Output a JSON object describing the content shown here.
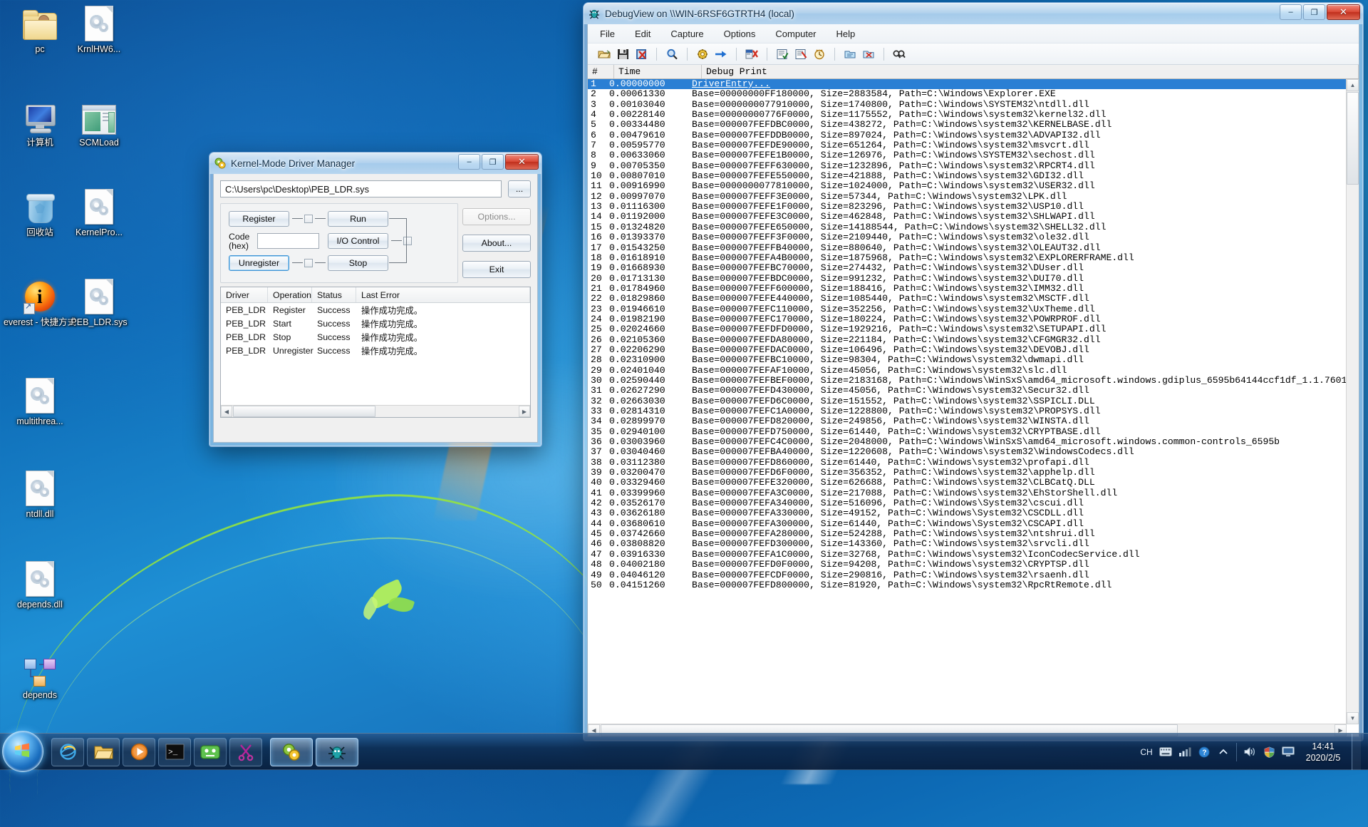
{
  "desktop": {
    "icons": [
      {
        "label": "pc",
        "type": "folder-user-icon"
      },
      {
        "label": "KrnlHW6...",
        "type": "file-gears-icon"
      },
      {
        "label": "计算机",
        "type": "computer-icon"
      },
      {
        "label": "SCMLoad",
        "type": "app-window-icon"
      },
      {
        "label": "回收站",
        "type": "recycle-bin-icon"
      },
      {
        "label": "KernelPro...",
        "type": "file-gears-icon"
      },
      {
        "label": "everest - 快捷方式",
        "type": "everest-shortcut-icon"
      },
      {
        "label": "PEB_LDR.sys",
        "type": "file-gears-icon"
      },
      {
        "label": "multithrea...",
        "type": "file-gears-icon"
      },
      {
        "label": "ntdll.dll",
        "type": "file-gears-icon"
      },
      {
        "label": "depends.dll",
        "type": "file-gears-icon"
      },
      {
        "label": "depends",
        "type": "depends-icon"
      }
    ]
  },
  "debugview": {
    "title": "DebugView on \\\\WIN-6RSF6GTRTH4 (local)",
    "menu": [
      "File",
      "Edit",
      "Capture",
      "Options",
      "Computer",
      "Help"
    ],
    "toolbar_icons": [
      "open-icon",
      "save-icon",
      "clear-icon",
      "find-icon",
      "capture-win32-icon",
      "capture-kernel-icon",
      "autoscroll-icon",
      "filter-icon",
      "highlight-icon",
      "clock-icon",
      "log-to-file-icon",
      "log-boot-icon",
      "find-next-icon"
    ],
    "columns": [
      "#",
      "Time",
      "Debug Print"
    ],
    "window_buttons": {
      "minimize": "–",
      "maximize": "❐",
      "close": "✕"
    },
    "rows": [
      {
        "n": "1",
        "t": "0.00000000",
        "p": "DriverEntry..."
      },
      {
        "n": "2",
        "t": "0.00061330",
        "p": "Base=00000000FF180000, Size=2883584, Path=C:\\Windows\\Explorer.EXE"
      },
      {
        "n": "3",
        "t": "0.00103040",
        "p": "Base=0000000077910000, Size=1740800, Path=C:\\Windows\\SYSTEM32\\ntdll.dll"
      },
      {
        "n": "4",
        "t": "0.00228140",
        "p": "Base=00000000776F0000, Size=1175552, Path=C:\\Windows\\system32\\kernel32.dll"
      },
      {
        "n": "5",
        "t": "0.00334480",
        "p": "Base=000007FEFDBC0000, Size=438272, Path=C:\\Windows\\system32\\KERNELBASE.dll"
      },
      {
        "n": "6",
        "t": "0.00479610",
        "p": "Base=000007FEFDDB0000, Size=897024, Path=C:\\Windows\\system32\\ADVAPI32.dll"
      },
      {
        "n": "7",
        "t": "0.00595770",
        "p": "Base=000007FEFDE90000, Size=651264, Path=C:\\Windows\\system32\\msvcrt.dll"
      },
      {
        "n": "8",
        "t": "0.00633060",
        "p": "Base=000007FEFE1B0000, Size=126976, Path=C:\\Windows\\SYSTEM32\\sechost.dll"
      },
      {
        "n": "9",
        "t": "0.00705350",
        "p": "Base=000007FEFF630000, Size=1232896, Path=C:\\Windows\\system32\\RPCRT4.dll"
      },
      {
        "n": "10",
        "t": "0.00807010",
        "p": "Base=000007FEFE550000, Size=421888, Path=C:\\Windows\\system32\\GDI32.dll"
      },
      {
        "n": "11",
        "t": "0.00916990",
        "p": "Base=0000000077810000, Size=1024000, Path=C:\\Windows\\system32\\USER32.dll"
      },
      {
        "n": "12",
        "t": "0.00997070",
        "p": "Base=000007FEFF3E0000, Size=57344, Path=C:\\Windows\\system32\\LPK.dll"
      },
      {
        "n": "13",
        "t": "0.01116300",
        "p": "Base=000007FEFE1F0000, Size=823296, Path=C:\\Windows\\system32\\USP10.dll"
      },
      {
        "n": "14",
        "t": "0.01192000",
        "p": "Base=000007FEFE3C0000, Size=462848, Path=C:\\Windows\\system32\\SHLWAPI.dll"
      },
      {
        "n": "15",
        "t": "0.01324820",
        "p": "Base=000007FEFE650000, Size=14188544, Path=C:\\Windows\\system32\\SHELL32.dll"
      },
      {
        "n": "16",
        "t": "0.01393370",
        "p": "Base=000007FEFF3F0000, Size=2109440, Path=C:\\Windows\\system32\\ole32.dll"
      },
      {
        "n": "17",
        "t": "0.01543250",
        "p": "Base=000007FEFFB40000, Size=880640, Path=C:\\Windows\\system32\\OLEAUT32.dll"
      },
      {
        "n": "18",
        "t": "0.01618910",
        "p": "Base=000007FEFA4B0000, Size=1875968, Path=C:\\Windows\\system32\\EXPLORERFRAME.dll"
      },
      {
        "n": "19",
        "t": "0.01668930",
        "p": "Base=000007FEFBC70000, Size=274432, Path=C:\\Windows\\system32\\DUser.dll"
      },
      {
        "n": "20",
        "t": "0.01713130",
        "p": "Base=000007FEFBDC0000, Size=991232, Path=C:\\Windows\\system32\\DUI70.dll"
      },
      {
        "n": "21",
        "t": "0.01784960",
        "p": "Base=000007FEFF600000, Size=188416, Path=C:\\Windows\\system32\\IMM32.dll"
      },
      {
        "n": "22",
        "t": "0.01829860",
        "p": "Base=000007FEFE440000, Size=1085440, Path=C:\\Windows\\system32\\MSCTF.dll"
      },
      {
        "n": "23",
        "t": "0.01946610",
        "p": "Base=000007FEFC110000, Size=352256, Path=C:\\Windows\\system32\\UxTheme.dll"
      },
      {
        "n": "24",
        "t": "0.01982190",
        "p": "Base=000007FEFC170000, Size=180224, Path=C:\\Windows\\system32\\POWRPROF.dll"
      },
      {
        "n": "25",
        "t": "0.02024660",
        "p": "Base=000007FEFDFD0000, Size=1929216, Path=C:\\Windows\\system32\\SETUPAPI.dll"
      },
      {
        "n": "26",
        "t": "0.02105360",
        "p": "Base=000007FEFDA80000, Size=221184, Path=C:\\Windows\\system32\\CFGMGR32.dll"
      },
      {
        "n": "27",
        "t": "0.02206290",
        "p": "Base=000007FEFDAC0000, Size=106496, Path=C:\\Windows\\system32\\DEVOBJ.dll"
      },
      {
        "n": "28",
        "t": "0.02310900",
        "p": "Base=000007FEFBC10000, Size=98304, Path=C:\\Windows\\system32\\dwmapi.dll"
      },
      {
        "n": "29",
        "t": "0.02401040",
        "p": "Base=000007FEFAF10000, Size=45056, Path=C:\\Windows\\system32\\slc.dll"
      },
      {
        "n": "30",
        "t": "0.02590440",
        "p": "Base=000007FEFBEF0000, Size=2183168, Path=C:\\Windows\\WinSxS\\amd64_microsoft.windows.gdiplus_6595b64144ccf1df_1.1.7601"
      },
      {
        "n": "31",
        "t": "0.02627290",
        "p": "Base=000007FEFD430000, Size=45056, Path=C:\\Windows\\system32\\Secur32.dll"
      },
      {
        "n": "32",
        "t": "0.02663030",
        "p": "Base=000007FEFD6C0000, Size=151552, Path=C:\\Windows\\system32\\SSPICLI.DLL"
      },
      {
        "n": "33",
        "t": "0.02814310",
        "p": "Base=000007FEFC1A0000, Size=1228800, Path=C:\\Windows\\system32\\PROPSYS.dll"
      },
      {
        "n": "34",
        "t": "0.02899970",
        "p": "Base=000007FEFD820000, Size=249856, Path=C:\\Windows\\system32\\WINSTA.dll"
      },
      {
        "n": "35",
        "t": "0.02940100",
        "p": "Base=000007FEFD750000, Size=61440, Path=C:\\Windows\\system32\\CRYPTBASE.dll"
      },
      {
        "n": "36",
        "t": "0.03003960",
        "p": "Base=000007FEFC4C0000, Size=2048000, Path=C:\\Windows\\WinSxS\\amd64_microsoft.windows.common-controls_6595b"
      },
      {
        "n": "37",
        "t": "0.03040460",
        "p": "Base=000007FEFBA40000, Size=1220608, Path=C:\\Windows\\system32\\WindowsCodecs.dll"
      },
      {
        "n": "38",
        "t": "0.03112380",
        "p": "Base=000007FEFD860000, Size=61440, Path=C:\\Windows\\system32\\profapi.dll"
      },
      {
        "n": "39",
        "t": "0.03200470",
        "p": "Base=000007FEFD6F0000, Size=356352, Path=C:\\Windows\\system32\\apphelp.dll"
      },
      {
        "n": "40",
        "t": "0.03329460",
        "p": "Base=000007FEFE320000, Size=626688, Path=C:\\Windows\\system32\\CLBCatQ.DLL"
      },
      {
        "n": "41",
        "t": "0.03399960",
        "p": "Base=000007FEFA3C0000, Size=217088, Path=C:\\Windows\\system32\\EhStorShell.dll"
      },
      {
        "n": "42",
        "t": "0.03526170",
        "p": "Base=000007FEFA340000, Size=516096, Path=C:\\Windows\\System32\\cscui.dll"
      },
      {
        "n": "43",
        "t": "0.03626180",
        "p": "Base=000007FEFA330000, Size=49152, Path=C:\\Windows\\System32\\CSCDLL.dll"
      },
      {
        "n": "44",
        "t": "0.03680610",
        "p": "Base=000007FEFA300000, Size=61440, Path=C:\\Windows\\System32\\CSCAPI.dll"
      },
      {
        "n": "45",
        "t": "0.03742660",
        "p": "Base=000007FEFA280000, Size=524288, Path=C:\\Windows\\system32\\ntshrui.dll"
      },
      {
        "n": "46",
        "t": "0.03808820",
        "p": "Base=000007FEFD300000, Size=143360, Path=C:\\Windows\\system32\\srvcli.dll"
      },
      {
        "n": "47",
        "t": "0.03916330",
        "p": "Base=000007FEFA1C0000, Size=32768, Path=C:\\Windows\\system32\\IconCodecService.dll"
      },
      {
        "n": "48",
        "t": "0.04002180",
        "p": "Base=000007FEFD0F0000, Size=94208, Path=C:\\Windows\\system32\\CRYPTSP.dll"
      },
      {
        "n": "49",
        "t": "0.04046120",
        "p": "Base=000007FEFCDF0000, Size=290816, Path=C:\\Windows\\system32\\rsaenh.dll"
      },
      {
        "n": "50",
        "t": "0.04151260",
        "p": "Base=000007FEFD800000, Size=81920, Path=C:\\Windows\\system32\\RpcRtRemote.dll"
      }
    ]
  },
  "kmdm": {
    "title": "Kernel-Mode Driver Manager",
    "window_buttons": {
      "minimize": "–",
      "maximize": "❐",
      "close": "✕"
    },
    "path_value": "C:\\Users\\pc\\Desktop\\PEB_LDR.sys",
    "browse_label": "...",
    "buttons": {
      "register": "Register",
      "run": "Run",
      "io_control": "I/O Control",
      "unregister": "Unregister",
      "stop": "Stop",
      "options": "Options...",
      "about": "About...",
      "exit": "Exit"
    },
    "code_label_line1": "Code",
    "code_label_line2": "(hex)",
    "code_value": "",
    "table": {
      "headers": [
        "Driver",
        "Operation",
        "Status",
        "Last Error"
      ],
      "rows": [
        {
          "driver": "PEB_LDR",
          "operation": "Register",
          "status": "Success",
          "error": "操作成功完成。"
        },
        {
          "driver": "PEB_LDR",
          "operation": "Start",
          "status": "Success",
          "error": "操作成功完成。"
        },
        {
          "driver": "PEB_LDR",
          "operation": "Stop",
          "status": "Success",
          "error": "操作成功完成。"
        },
        {
          "driver": "PEB_LDR",
          "operation": "Unregister",
          "status": "Success",
          "error": "操作成功完成。"
        }
      ]
    }
  },
  "taskbar": {
    "start_label": "Start",
    "quick_launch": [
      "ie-icon",
      "explorer-icon",
      "media-player-icon",
      "console-icon",
      "vm-icon",
      "snipping-tool-icon"
    ],
    "running": [
      "driver-manager-task",
      "debugview-task"
    ],
    "tray": {
      "ime": "CH",
      "icons": [
        "keyboard-icon",
        "network-icon",
        "help-icon",
        "chevron-up-icon",
        "volume-icon",
        "shield-icon",
        "monitor-icon"
      ],
      "time": "14:41",
      "date": "2020/2/5"
    }
  }
}
